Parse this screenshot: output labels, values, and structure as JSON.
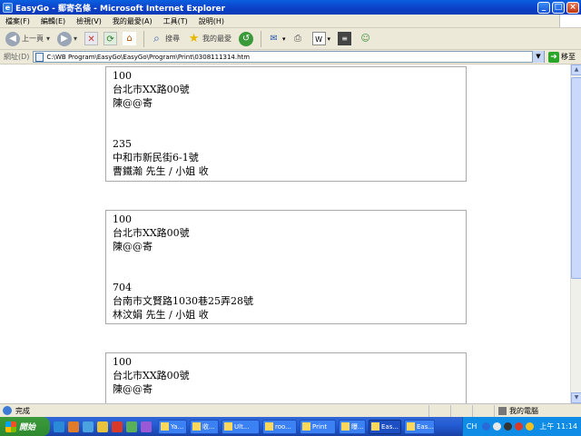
{
  "window": {
    "title": "EasyGo - 郵寄名條 - Microsoft Internet Explorer",
    "buttons": {
      "minimize": "_",
      "maximize": "□",
      "close": "×"
    }
  },
  "menubar": {
    "items": [
      "檔案(F)",
      "編輯(E)",
      "檢視(V)",
      "我的最愛(A)",
      "工具(T)",
      "說明(H)"
    ]
  },
  "toolbar": {
    "back": "上一頁",
    "search": "搜尋",
    "favorites": "我的最愛"
  },
  "addressbar": {
    "label": "網址(D)",
    "url": "C:\\WB Program\\EasyGo\\EasyGo\\Program\\Print\\0308111314.htm",
    "go": "移至"
  },
  "labels": [
    {
      "sender_zip": "100",
      "sender_address": "台北市XX路00號",
      "sender_name": "陳@@寄",
      "recipient_zip": "235",
      "recipient_address": "中和市新民街6-1號",
      "recipient_name": "曹鐵瀚 先生 / 小姐 收"
    },
    {
      "sender_zip": "100",
      "sender_address": "台北市XX路00號",
      "sender_name": "陳@@寄",
      "recipient_zip": "704",
      "recipient_address": "台南市文賢路1030巷25弄28號",
      "recipient_name": "林汶娟 先生 / 小姐 收"
    },
    {
      "sender_zip": "100",
      "sender_address": "台北市XX路00號",
      "sender_name": "陳@@寄"
    }
  ],
  "statusbar": {
    "status": "完成",
    "zone": "我的電腦"
  },
  "taskbar": {
    "start": "開始",
    "tasks": [
      "Ya...",
      "收...",
      "Ult...",
      "roo...",
      "Print",
      "曝...",
      "Eas...",
      "Eas..."
    ],
    "lang": "CH",
    "clock": "上午 11:14"
  }
}
